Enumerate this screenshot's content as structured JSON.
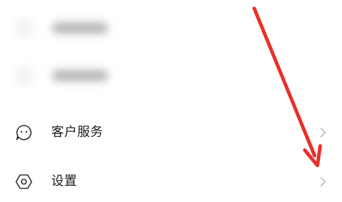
{
  "menu": {
    "items": [
      {
        "label": "客户服务",
        "icon": "chat-face-icon"
      },
      {
        "label": "设置",
        "icon": "hexagon-settings-icon"
      }
    ]
  },
  "annotation": {
    "arrow_color": "#e8302c",
    "icon": "red-arrow"
  },
  "colors": {
    "text": "#1c1c1c",
    "icon_stroke": "#2b2b2b",
    "chevron": "#bdbdbd"
  }
}
